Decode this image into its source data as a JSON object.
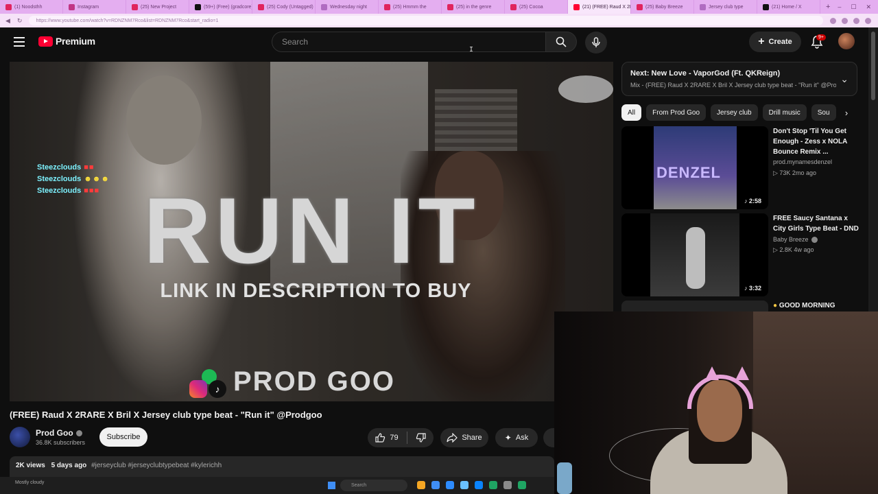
{
  "browser": {
    "tabs": [
      {
        "label": "(1) Noodsthh",
        "color": "#e0245e",
        "active": false
      },
      {
        "label": "Instagram",
        "color": "#c13584",
        "active": false
      },
      {
        "label": "(25) New Project",
        "color": "#e0245e",
        "active": false
      },
      {
        "label": "(59+) (Free) (gradcore)",
        "color": "#111111",
        "active": false
      },
      {
        "label": "(25) Cody (Untagged)",
        "color": "#e0245e",
        "active": false
      },
      {
        "label": "Wednesday night",
        "color": "#b06cc1",
        "active": false
      },
      {
        "label": "(25) Hmmm the",
        "color": "#e0245e",
        "active": false
      },
      {
        "label": "(25) in the genre",
        "color": "#e0245e",
        "active": false
      },
      {
        "label": "(25) Cocoa",
        "color": "#e0245e",
        "active": false
      },
      {
        "label": "(21) (FREE) Raud X 2R",
        "color": "#ff0033",
        "active": true
      },
      {
        "label": "(25) Baby Breeze",
        "color": "#e0245e",
        "active": false
      },
      {
        "label": "Jersey club type",
        "color": "#b06cc1",
        "active": false
      },
      {
        "label": "(21) Home / X",
        "color": "#111111",
        "active": false
      }
    ],
    "new_tab": "+",
    "window_controls": [
      "–",
      "☐",
      "✕"
    ],
    "url": "https://www.youtube.com/watch?v=RDNZNM7Rco&list=RDNZNM7Rco&start_radio=1"
  },
  "header": {
    "logo_text": "Premium",
    "search_placeholder": "Search",
    "create_label": "Create",
    "notification_count": "9+"
  },
  "player": {
    "chat": [
      {
        "user": "Steezclouds",
        "emotes": "■■",
        "tone": "red"
      },
      {
        "user": "Steezclouds",
        "emotes": "☻☻☻",
        "tone": "yellow"
      },
      {
        "user": "Steezclouds",
        "emotes": "■■■",
        "tone": "red"
      }
    ],
    "overlay_title": "RUN IT",
    "overlay_subtitle": "LINK IN DESCRIPTION TO BUY",
    "overlay_brand": "PROD GOO",
    "tiktok_glyph": "♪"
  },
  "video": {
    "title": "(FREE) Raud X 2RARE X Bril X Jersey club type beat - \"Run it\" @Prodgoo",
    "channel_name": "Prod Goo",
    "subscribers": "36.8K subscribers",
    "subscribe_label": "Subscribe",
    "likes": "79",
    "share_label": "Share",
    "ask_label": "Ask",
    "views": "2K views",
    "age": "5 days ago",
    "tags": "#jerseyclub #jerseyclubtypebeat #kylerichh"
  },
  "sidebar": {
    "next_title": "Next: New Love - VaporGod (Ft. QKReign)",
    "next_subtitle": "Mix - (FREE) Raud X 2RARE X Bril X Jersey club type beat - \"Run it\" @Prodgoo",
    "chips": [
      {
        "label": "All",
        "active": true
      },
      {
        "label": "From Prod Goo",
        "active": false
      },
      {
        "label": "Jersey club",
        "active": false
      },
      {
        "label": "Drill music",
        "active": false
      },
      {
        "label": "Sou",
        "active": false
      }
    ],
    "recommendations": [
      {
        "title": "Don't Stop 'Til You Get Enough - Zess x NOLA Bounce Remix ...",
        "channel": "prod.mynamesdenzel",
        "stats": "73K  2mo ago",
        "duration": "2:58",
        "thumb_text": "DENZEL"
      },
      {
        "title": "FREE Saucy Santana x City Girls Type Beat - DND",
        "channel": "Baby Breeze",
        "stats": "2.8K  4w ago",
        "duration": "3:32",
        "thumb_text": ""
      }
    ],
    "partial_item_title": "GOOD MORNING"
  },
  "taskbar": {
    "search_placeholder": "Search",
    "weather": "Mostly cloudy",
    "icon_colors": [
      "#f5a623",
      "#3f8ef5",
      "#2d8cff",
      "#6ac1ff",
      "#0a84ff",
      "#1fa463",
      "#8a8a8a",
      "#1fa463"
    ]
  }
}
